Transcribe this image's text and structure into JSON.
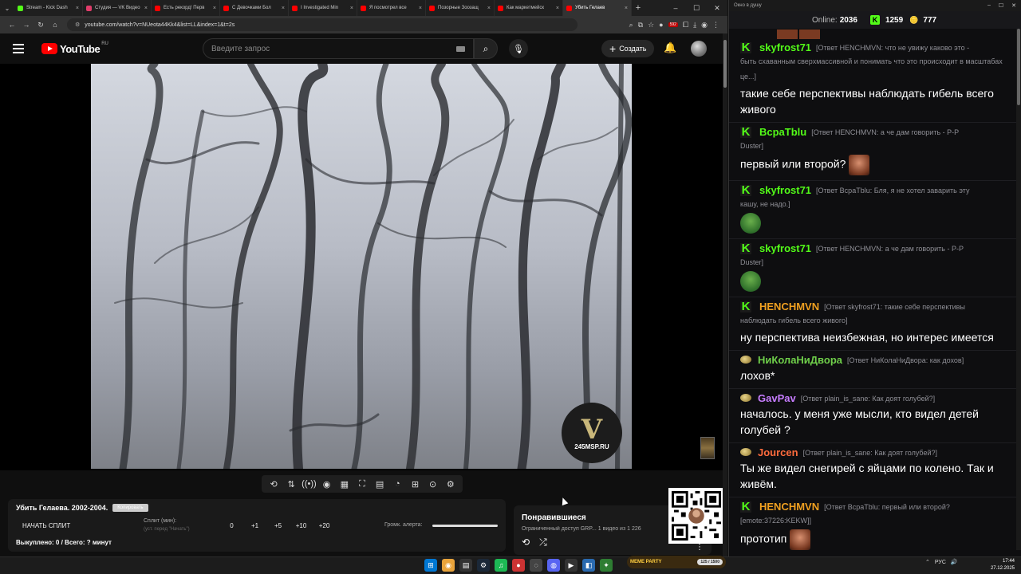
{
  "browser": {
    "tabs": [
      {
        "label": "Stream - Kick Dash",
        "color": "#53fc18"
      },
      {
        "label": "Студия — VK Видео",
        "color": "#e03c6a"
      },
      {
        "label": "Есть рекорд! Перв",
        "color": "#ff0000"
      },
      {
        "label": "С Девочками Бол",
        "color": "#ff0000"
      },
      {
        "label": "I Investigated Min",
        "color": "#ff0000"
      },
      {
        "label": "Я посмотрел все",
        "color": "#ff0000"
      },
      {
        "label": "Позорные Зоозащ",
        "color": "#ff0000"
      },
      {
        "label": "Как маркетмейск",
        "color": "#ff0000"
      },
      {
        "label": "Убить Гелаев",
        "color": "#ff0000"
      }
    ],
    "url": "youtube.com/watch?v=NUeota44Kk4&list=LL&index=1&t=2s",
    "ext_badge": "592"
  },
  "youtube": {
    "logo_text": "YouTube",
    "region": "RU",
    "search_placeholder": "Введите запрос",
    "create_label": "Создать"
  },
  "video": {
    "watermark_text": "245MSP.RU"
  },
  "split_panel": {
    "title": "Убить Гелаева. 2002-2004.",
    "tag": "Копировать",
    "start_label": "НАЧАТЬ СПЛИТ",
    "split_label": "Сплит (мин):",
    "split_note": "(уст. перед \"Начать\")",
    "nums": [
      "0",
      "+1",
      "+5",
      "+10",
      "+20"
    ],
    "alert_label": "Громк. алерта:",
    "bought": "Выкуплено: 0 / Всего: ? минут"
  },
  "liked": {
    "title": "Понравившиеся",
    "sub": "Ограниченный доступ GRP... 1 видео из 1 226"
  },
  "chat": {
    "window_title": "Окно в душу",
    "online_label": "Online:",
    "online_value": "2036",
    "k_value": "1259",
    "coin_value": "777",
    "messages": [
      {
        "badge": "k",
        "user": "skyfrost71",
        "color": "#53fc18",
        "reply": "[Ответ HENCHMVN: что не увижу каково это -",
        "reply_cont": "быть схаванным сверхмассивной и понимать что это происходит в масштабах це...]",
        "text": "такие себе перспективы наблюдать гибель всего живого",
        "emote": ""
      },
      {
        "badge": "k",
        "user": "BcpaTblu",
        "color": "#53fc18",
        "reply": "[Ответ HENCHMVN: а че дам говорить - P-P",
        "reply_cont": "Duster]",
        "text": "первый или второй?",
        "emote": "face"
      },
      {
        "badge": "k",
        "user": "skyfrost71",
        "color": "#53fc18",
        "reply": "[Ответ BcpaTblu: Бля, я не хотел заварить эту",
        "reply_cont": "кашу, не надо.]",
        "text": "",
        "emote": "pepe"
      },
      {
        "badge": "k",
        "user": "skyfrost71",
        "color": "#53fc18",
        "reply": "[Ответ HENCHMVN: а че дам говорить - P-P",
        "reply_cont": "Duster]",
        "text": "",
        "emote": "pepe"
      },
      {
        "badge": "k",
        "user": "HENCHMVN",
        "color": "#f0a020",
        "reply": "[Ответ skyfrost71: такие себе перспективы",
        "reply_cont": "наблюдать гибель всего живого]",
        "text": "ну перспектива неизбежная, но интерес имеется",
        "emote": ""
      },
      {
        "badge": "coin",
        "user": "НиКолаНиДвора",
        "color": "#6fcf4a",
        "reply": "[Ответ НиКолаНиДвора: как дохов]",
        "reply_cont": "",
        "text": "лохов*",
        "emote": ""
      },
      {
        "badge": "coin",
        "user": "GavPav",
        "color": "#c77dff",
        "reply": "[Ответ plain_is_sane: Как доят голубей?]",
        "reply_cont": "",
        "text": "началось. у меня уже мысли, кто видел детей голубей ?",
        "emote": ""
      },
      {
        "badge": "coin",
        "user": "Jourcen",
        "color": "#ff6b3d",
        "reply": "[Ответ plain_is_sane: Как доят голубей?]",
        "reply_cont": "",
        "text": "Ты же видел снегирей с яйцами по колено. Так и живём.",
        "emote": ""
      },
      {
        "badge": "k",
        "user": "HENCHMVN",
        "color": "#f0a020",
        "reply": "[Ответ BcpaTblu: первый или второй?",
        "reply_cont": "[emote:37226:KEKW]]",
        "text": "прототип",
        "emote": "face"
      }
    ]
  },
  "taskbar": {
    "meme_party": "MEME PARTY",
    "meme_party_count": "125 / 1500",
    "lang": "РУС",
    "time": "17:44",
    "date": "27.12.2025"
  }
}
